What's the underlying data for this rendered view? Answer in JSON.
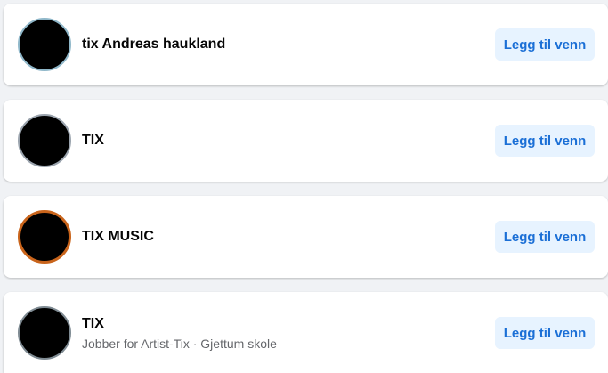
{
  "results": [
    {
      "name": "tix Andreas haukland",
      "subtitle": "",
      "button_label": "Legg til venn"
    },
    {
      "name": "TIX",
      "subtitle": "",
      "button_label": "Legg til venn"
    },
    {
      "name": "TIX MUSIC",
      "subtitle": "",
      "button_label": "Legg til venn"
    },
    {
      "name": "TIX",
      "subtitle": "Jobber for Artist-Tix · Gjettum skole",
      "button_label": "Legg til venn"
    }
  ],
  "colors": {
    "page_background": "#f0f2f5",
    "card_background": "#ffffff",
    "button_background": "#e7f3ff",
    "button_text": "#1b6fd6",
    "name_text": "#050505",
    "subtitle_text": "#65676b"
  },
  "icons": {
    "avatar": "profile-avatar"
  }
}
